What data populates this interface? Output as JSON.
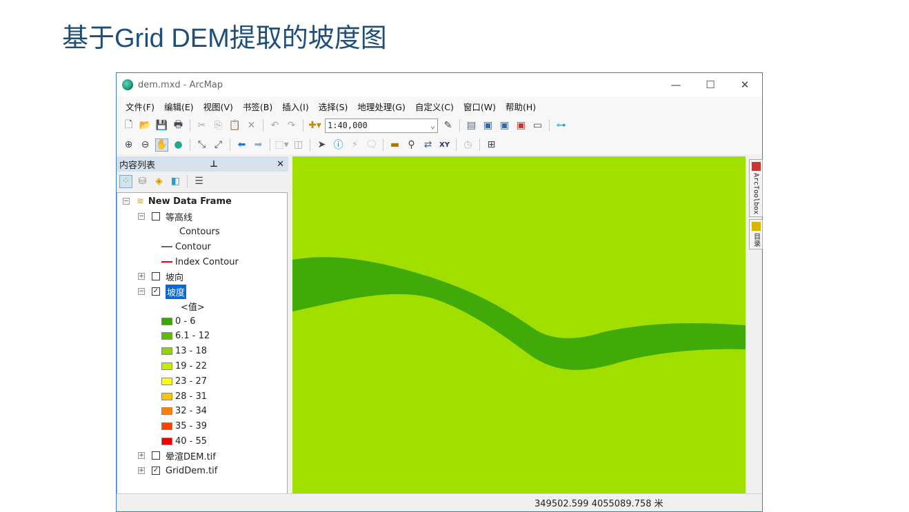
{
  "slide_title": "基于Grid DEM提取的坡度图",
  "window": {
    "title": "dem.mxd - ArcMap",
    "controls": [
      "—",
      "☐",
      "✕"
    ]
  },
  "menu": [
    "文件(F)",
    "编辑(E)",
    "视图(V)",
    "书签(B)",
    "插入(I)",
    "选择(S)",
    "地理处理(G)",
    "自定义(C)",
    "窗口(W)",
    "帮助(H)"
  ],
  "toolbar": {
    "scale": "1:40,000"
  },
  "toc": {
    "title": "内容列表",
    "pin": "♁",
    "close": "✕",
    "frame": "New Data Frame",
    "contour_layer": "等高线",
    "contour_heading": "Contours",
    "contour": "Contour",
    "index_contour": "Index Contour",
    "aspect_layer": "坡向",
    "slope_layer": "坡度",
    "slope_heading": "<值>",
    "classes": [
      {
        "label": "0 - 6",
        "color": "#38a800"
      },
      {
        "label": "6.1 - 12",
        "color": "#5cbc00"
      },
      {
        "label": "13 - 18",
        "color": "#8fd400"
      },
      {
        "label": "19 - 22",
        "color": "#c8ea00"
      },
      {
        "label": "23 - 27",
        "color": "#ffff00"
      },
      {
        "label": "28 - 31",
        "color": "#ffc200"
      },
      {
        "label": "32 - 34",
        "color": "#ff8000"
      },
      {
        "label": "35 - 39",
        "color": "#ff4400"
      },
      {
        "label": "40 - 55",
        "color": "#f00000"
      }
    ],
    "hillshade_layer": "晕渲DEM.tif",
    "grid_layer": "GridDem.tif"
  },
  "side": {
    "toolbox": "ArcToolbox",
    "catalog": "目录"
  },
  "status": {
    "coords": "349502.599  4055089.758 米"
  }
}
